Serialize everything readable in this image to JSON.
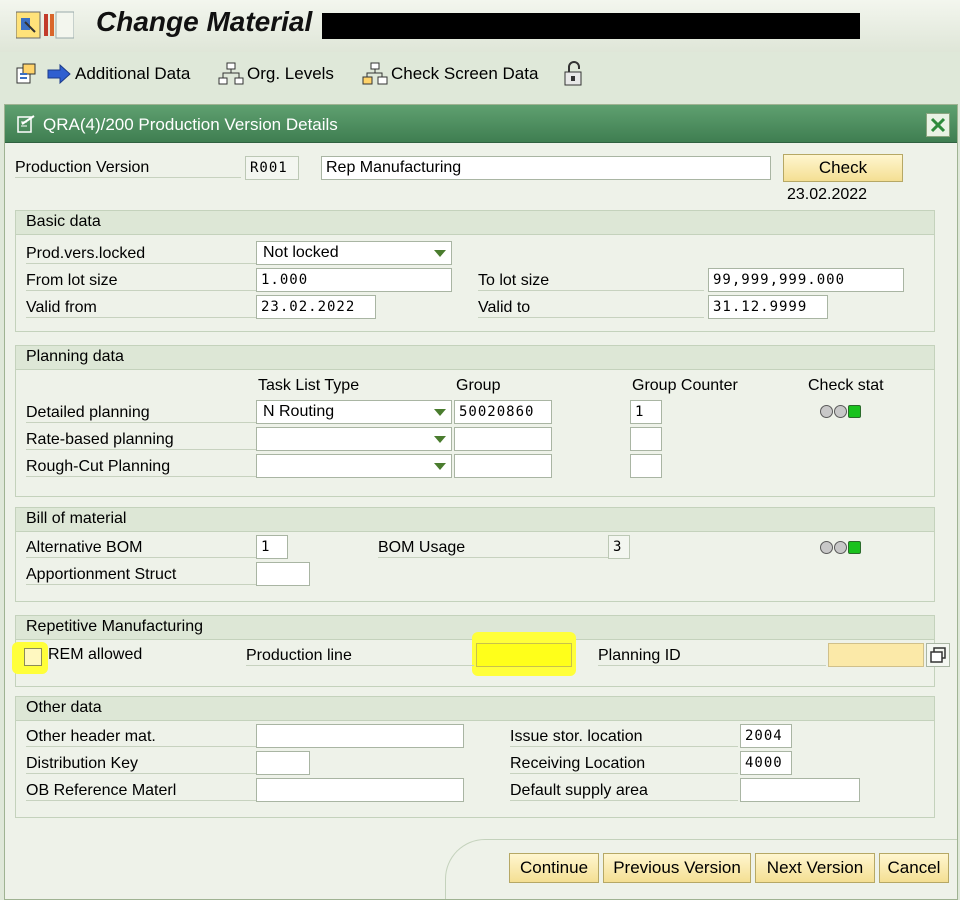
{
  "window": {
    "title": "Change Material"
  },
  "toolbar": {
    "additional_data": "Additional Data",
    "org_levels": "Org. Levels",
    "check_screen_data": "Check Screen Data"
  },
  "dialog": {
    "title": "QRA(4)/200 Production Version Details",
    "production_version_label": "Production Version",
    "production_version_value": "R001",
    "production_version_text": "Rep Manufacturing",
    "check_button": "Check",
    "date": "23.02.2022"
  },
  "basic_data": {
    "heading": "Basic data",
    "locked_label": "Prod.vers.locked",
    "locked_value": "Not locked",
    "from_lot_label": "From lot size",
    "from_lot_value": "1.000",
    "to_lot_label": "To lot size",
    "to_lot_value": "99,999,999.000",
    "valid_from_label": "Valid from",
    "valid_from_value": "23.02.2022",
    "valid_to_label": "Valid to",
    "valid_to_value": "31.12.9999"
  },
  "planning_data": {
    "heading": "Planning data",
    "col_task_list_type": "Task List Type",
    "col_group": "Group",
    "col_group_counter": "Group Counter",
    "col_check_stat": "Check stat",
    "rows": [
      {
        "label": "Detailed planning",
        "task_list_type": "N Routing",
        "group": "50020860",
        "group_counter": "1"
      },
      {
        "label": "Rate-based planning",
        "task_list_type": "",
        "group": "",
        "group_counter": ""
      },
      {
        "label": "Rough-Cut Planning",
        "task_list_type": "",
        "group": "",
        "group_counter": ""
      }
    ]
  },
  "bom": {
    "heading": "Bill of material",
    "alt_bom_label": "Alternative BOM",
    "alt_bom_value": "1",
    "usage_label": "BOM Usage",
    "usage_value": "3",
    "apportionment_label": "Apportionment Struct",
    "apportionment_value": ""
  },
  "rem": {
    "heading": "Repetitive Manufacturing",
    "rem_allowed_label": "REM allowed",
    "production_line_label": "Production line",
    "production_line_value": "",
    "planning_id_label": "Planning ID",
    "planning_id_value": ""
  },
  "other": {
    "heading": "Other data",
    "other_header_label": "Other header mat.",
    "other_header_value": "",
    "issue_loc_label": "Issue stor. location",
    "issue_loc_value": "2004",
    "dist_key_label": "Distribution Key",
    "dist_key_value": "",
    "recv_loc_label": "Receiving Location",
    "recv_loc_value": "4000",
    "ob_ref_label": "OB Reference Materl",
    "ob_ref_value": "",
    "supply_area_label": "Default supply area",
    "supply_area_value": ""
  },
  "footer": {
    "continue": "Continue",
    "previous": "Previous Version",
    "next": "Next Version",
    "cancel": "Cancel"
  },
  "colors": {
    "dialog_header": "#3f7e51",
    "button_yellow": "#f4df93",
    "highlight": "#ffff3a",
    "light_green": "#19c21d"
  }
}
